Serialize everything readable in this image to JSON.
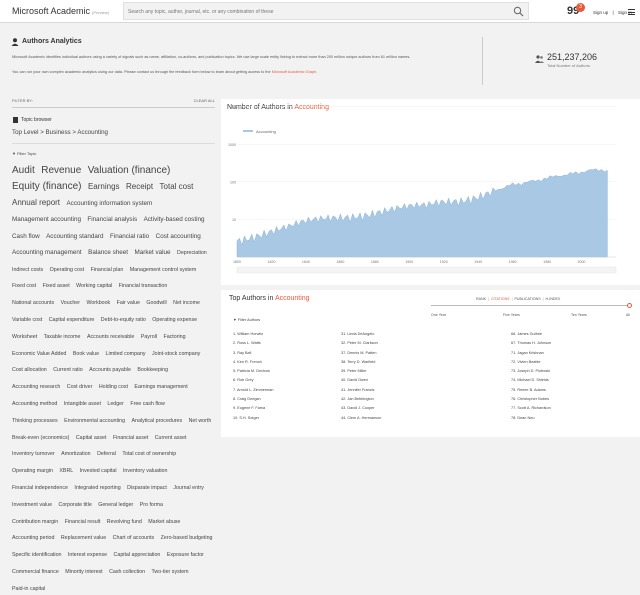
{
  "header": {
    "brand": "Microsoft Academic",
    "brand_sub": "(Preview)",
    "search_placeholder": "Search any topic, author, journal, etc. or any combination of these",
    "quote_glyph": "99",
    "notification_count": "3",
    "sign_up_label": "Sign up",
    "divider": "|",
    "sign_in_label": "Sign in",
    "icons": [
      "search-icon",
      "quote-icon",
      "menu-icon"
    ]
  },
  "page": {
    "title": "Authors Analytics",
    "description_1": "Microsoft Academic identifies individual authors using a variety of signals such as name, affiliation, co-authors, and publication topics. We use large scale entity linking to extract more than 200 million unique authors from 61 million names.",
    "description_2": "You can run your own complex academic analytics using our data. Please contact us through the feedback form below to learn about getting access to the",
    "description_link": "Microsoft Academic Graph.",
    "total_count": "251,237,206",
    "total_label": "Total Number of Authors"
  },
  "filters": {
    "filter_by": "FILTER BY:",
    "clear_all": "CLEAR ALL",
    "topic_browser": "Topic browser",
    "topic_path": "Top Level > Business > Accounting",
    "filter_topic": "Filter Topic",
    "tags": [
      {
        "label": "Audit",
        "size": 1
      },
      {
        "label": "Revenue",
        "size": 1
      },
      {
        "label": "Valuation (finance)",
        "size": 1
      },
      {
        "label": "Equity (finance)",
        "size": 1
      },
      {
        "label": "Earnings",
        "size": 2
      },
      {
        "label": "Receipt",
        "size": 2
      },
      {
        "label": "Total cost",
        "size": 2
      },
      {
        "label": "Annual report",
        "size": 2
      },
      {
        "label": "Accounting information system",
        "size": 3
      },
      {
        "label": "Management accounting",
        "size": 3
      },
      {
        "label": "Financial analysis",
        "size": 3
      },
      {
        "label": "Activity-based costing",
        "size": 3
      },
      {
        "label": "Cash flow",
        "size": 3
      },
      {
        "label": "Accounting standard",
        "size": 3
      },
      {
        "label": "Financial ratio",
        "size": 3
      },
      {
        "label": "Cost accounting",
        "size": 3
      },
      {
        "label": "Accounting management",
        "size": 3
      },
      {
        "label": "Balance sheet",
        "size": 3
      },
      {
        "label": "Market value",
        "size": 3
      },
      {
        "label": "Depreciation",
        "size": 4
      },
      {
        "label": "Indirect costs",
        "size": 4
      },
      {
        "label": "Operating cost",
        "size": 4
      },
      {
        "label": "Financial plan",
        "size": 4
      },
      {
        "label": "Management control system",
        "size": 4
      },
      {
        "label": "Fixed cost",
        "size": 4
      },
      {
        "label": "Fixed asset",
        "size": 4
      },
      {
        "label": "Working capital",
        "size": 4
      },
      {
        "label": "Financial transaction",
        "size": 4
      },
      {
        "label": "National accounts",
        "size": 4
      },
      {
        "label": "Voucher",
        "size": 4
      },
      {
        "label": "Workbook",
        "size": 4
      },
      {
        "label": "Fair value",
        "size": 4
      },
      {
        "label": "Goodwill",
        "size": 4
      },
      {
        "label": "Net income",
        "size": 4
      },
      {
        "label": "Variable cost",
        "size": 4
      },
      {
        "label": "Capital expenditure",
        "size": 4
      },
      {
        "label": "Debt-to-equity ratio",
        "size": 4
      },
      {
        "label": "Operating expense",
        "size": 4
      },
      {
        "label": "Worksheet",
        "size": 4
      },
      {
        "label": "Taxable income",
        "size": 4
      },
      {
        "label": "Accounts receivable",
        "size": 4
      },
      {
        "label": "Payroll",
        "size": 4
      },
      {
        "label": "Factoring",
        "size": 4
      },
      {
        "label": "Economic Value Added",
        "size": 4
      },
      {
        "label": "Book value",
        "size": 4
      },
      {
        "label": "Limited company",
        "size": 4
      },
      {
        "label": "Joint-stock company",
        "size": 4
      },
      {
        "label": "Cost allocation",
        "size": 4
      },
      {
        "label": "Current ratio",
        "size": 4
      },
      {
        "label": "Accounts payable",
        "size": 4
      },
      {
        "label": "Bookkeeping",
        "size": 4
      },
      {
        "label": "Accounting research",
        "size": 4
      },
      {
        "label": "Cost driver",
        "size": 4
      },
      {
        "label": "Holding cost",
        "size": 4
      },
      {
        "label": "Earnings management",
        "size": 4
      },
      {
        "label": "Accounting method",
        "size": 4
      },
      {
        "label": "Intangible asset",
        "size": 4
      },
      {
        "label": "Ledger",
        "size": 4
      },
      {
        "label": "Free cash flow",
        "size": 4
      },
      {
        "label": "Thinking processes",
        "size": 4
      },
      {
        "label": "Environmental accounting",
        "size": 4
      },
      {
        "label": "Analytical procedures",
        "size": 4
      },
      {
        "label": "Net worth",
        "size": 4
      },
      {
        "label": "Break-even (economics)",
        "size": 4
      },
      {
        "label": "Capital asset",
        "size": 4
      },
      {
        "label": "Financial asset",
        "size": 4
      },
      {
        "label": "Current asset",
        "size": 4
      },
      {
        "label": "Inventory turnover",
        "size": 4
      },
      {
        "label": "Amortization",
        "size": 4
      },
      {
        "label": "Deferral",
        "size": 4
      },
      {
        "label": "Total cost of ownership",
        "size": 4
      },
      {
        "label": "Operating margin",
        "size": 4
      },
      {
        "label": "XBRL",
        "size": 4
      },
      {
        "label": "Invested capital",
        "size": 4
      },
      {
        "label": "Inventory valuation",
        "size": 4
      },
      {
        "label": "Financial independence",
        "size": 4
      },
      {
        "label": "Integrated reporting",
        "size": 4
      },
      {
        "label": "Disparate impact",
        "size": 4
      },
      {
        "label": "Journal entry",
        "size": 4
      },
      {
        "label": "Investment value",
        "size": 4
      },
      {
        "label": "Corporate title",
        "size": 4
      },
      {
        "label": "General ledger",
        "size": 4
      },
      {
        "label": "Pro forma",
        "size": 4
      },
      {
        "label": "Contribution margin",
        "size": 4
      },
      {
        "label": "Financial result",
        "size": 4
      },
      {
        "label": "Revolving fund",
        "size": 4
      },
      {
        "label": "Market abuse",
        "size": 4
      },
      {
        "label": "Accounting period",
        "size": 4
      },
      {
        "label": "Replacement value",
        "size": 4
      },
      {
        "label": "Chart of accounts",
        "size": 4
      },
      {
        "label": "Zero-based budgeting",
        "size": 4
      },
      {
        "label": "Specific identification",
        "size": 4
      },
      {
        "label": "Interest expense",
        "size": 4
      },
      {
        "label": "Capital appreciation",
        "size": 4
      },
      {
        "label": "Exposure factor",
        "size": 4
      },
      {
        "label": "Commercial finance",
        "size": 4
      },
      {
        "label": "Minority interest",
        "size": 4
      },
      {
        "label": "Cash collection",
        "size": 4
      },
      {
        "label": "Two-tier system",
        "size": 4
      },
      {
        "label": "Paid-in capital",
        "size": 4
      }
    ]
  },
  "chart": {
    "title_prefix": "Number of Authors in",
    "title_topic": "Accounting",
    "legend_label": "Accounting",
    "accent": "#e8593a",
    "series_color": "#a8c8e4"
  },
  "chart_data": {
    "type": "area",
    "title": "Number of Authors in Accounting",
    "series": [
      {
        "name": "Accounting",
        "color": "#a8c8e4"
      }
    ],
    "x": [
      1800,
      1810,
      1820,
      1830,
      1840,
      1850,
      1860,
      1870,
      1880,
      1890,
      1900,
      1910,
      1920,
      1930,
      1940,
      1950,
      1955,
      1960,
      1965,
      1970,
      1975,
      1980,
      1985,
      1990,
      1995,
      2000,
      2005,
      2010,
      2015
    ],
    "y": [
      3,
      4,
      5,
      6,
      8,
      10,
      12,
      14,
      16,
      18,
      20,
      22,
      30,
      35,
      45,
      60,
      70,
      85,
      90,
      100,
      110,
      125,
      140,
      150,
      165,
      180,
      200,
      210,
      200
    ],
    "x_ticks": [
      "1800",
      "1820",
      "1840",
      "1860",
      "1880",
      "1900",
      "1920",
      "1940",
      "1960",
      "1980",
      "2000"
    ],
    "y_ticks": [
      "0",
      "10",
      "100",
      "1000",
      "10k"
    ],
    "xlim": [
      1800,
      2020
    ],
    "scale": "log",
    "legend": "top-left"
  },
  "top_authors": {
    "title_prefix": "Top Authors in",
    "title_topic": "Accounting",
    "tabs": [
      "RANK",
      "CITATIONS",
      "PUBLICATIONS",
      "H-INDEX"
    ],
    "active_tab": "CITATIONS",
    "filter_label": "Filter Authors",
    "slider_labels": [
      "One Year",
      "Five Years",
      "Ten Years",
      "All"
    ],
    "columns": [
      [
        "1. William Horwitz",
        "2. Ross L. Watts",
        "3. Ray Ball",
        "4. Ken R. French",
        "5. Patricia M. Dechow",
        "6. Rob Grey",
        "7. Arnold L. Zimmerman",
        "8. Craig Deegan",
        "9. Eugene F. Fama",
        "10. S.H. Sotger"
      ],
      [
        "31. Linda DeAngelo",
        "32. Peter M. Clarkson",
        "37. Dennis M. Patten",
        "38. Terry D. Warfield",
        "39. Peter Miller",
        "40. David Owen",
        "41. Jennifer Francis",
        "42. Jan Bebbington",
        "43. David J. Cooper",
        "44. Clem A. Hermanson"
      ],
      [
        "66. James Guthrie",
        "67. Thomas H. Johnson",
        "71. Jagan Krishnan",
        "72. Vivien Beattie",
        "73. Joseph D. Piotroski",
        "74. Michael D. Shields",
        "75. Renee B. Adams",
        "76. Christopher Nobes",
        "77. Scott A. Richardson",
        "78. Dean Neu"
      ]
    ]
  }
}
